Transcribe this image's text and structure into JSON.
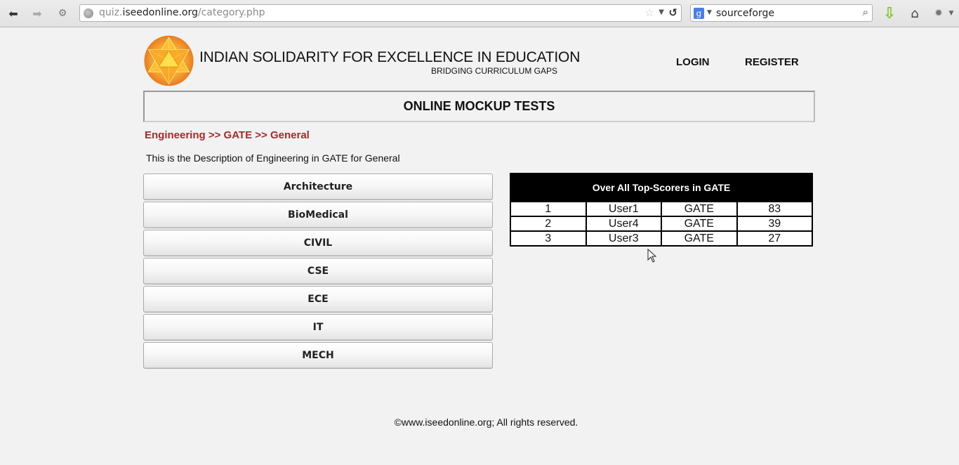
{
  "browser": {
    "url_prefix": "quiz.",
    "url_domain": "iseedonline.org",
    "url_path": "/category.php",
    "search_value": "sourceforge",
    "icons": {
      "back": "back-arrow-icon",
      "forward": "forward-arrow-icon",
      "history": "history-icon",
      "site": "globe-icon",
      "bookmark": "star-icon",
      "url_dropdown": "dropdown-arrow-icon",
      "reload": "reload-icon",
      "search_engine": "google-icon",
      "search": "magnifier-icon",
      "download": "download-arrow-icon",
      "home": "home-icon",
      "addon": "addon-icon"
    },
    "search_engine_glyph": "g"
  },
  "header": {
    "title": "INDIAN SOLIDARITY FOR EXCELLENCE IN EDUCATION",
    "subtitle": "BRIDGING CURRICULUM GAPS",
    "nav": {
      "login": "LOGIN",
      "register": "REGISTER"
    }
  },
  "banner": {
    "title": "ONLINE MOCKUP TESTS"
  },
  "breadcrumb": {
    "items": [
      "Engineering",
      "GATE",
      "General"
    ],
    "separator": ">>"
  },
  "description": "This is the Description of Engineering in GATE for General",
  "categories": [
    {
      "label": "Architecture"
    },
    {
      "label": "BioMedical"
    },
    {
      "label": "CIVIL"
    },
    {
      "label": "CSE"
    },
    {
      "label": "ECE"
    },
    {
      "label": "IT"
    },
    {
      "label": "MECH"
    }
  ],
  "top_scorers": {
    "title": "Over All Top-Scorers in GATE",
    "rows": [
      {
        "rank": "1",
        "user": "User1",
        "exam": "GATE",
        "score": "83"
      },
      {
        "rank": "2",
        "user": "User4",
        "exam": "GATE",
        "score": "39"
      },
      {
        "rank": "3",
        "user": "User3",
        "exam": "GATE",
        "score": "27"
      }
    ]
  },
  "footer": {
    "text": "©www.iseedonline.org; All rights reserved."
  },
  "colors": {
    "breadcrumb": "#a52a2a",
    "background": "#f2f2f2",
    "table_header_bg": "#000000",
    "logo_orange": "#f08a24",
    "logo_yellow": "#fcd33a"
  }
}
